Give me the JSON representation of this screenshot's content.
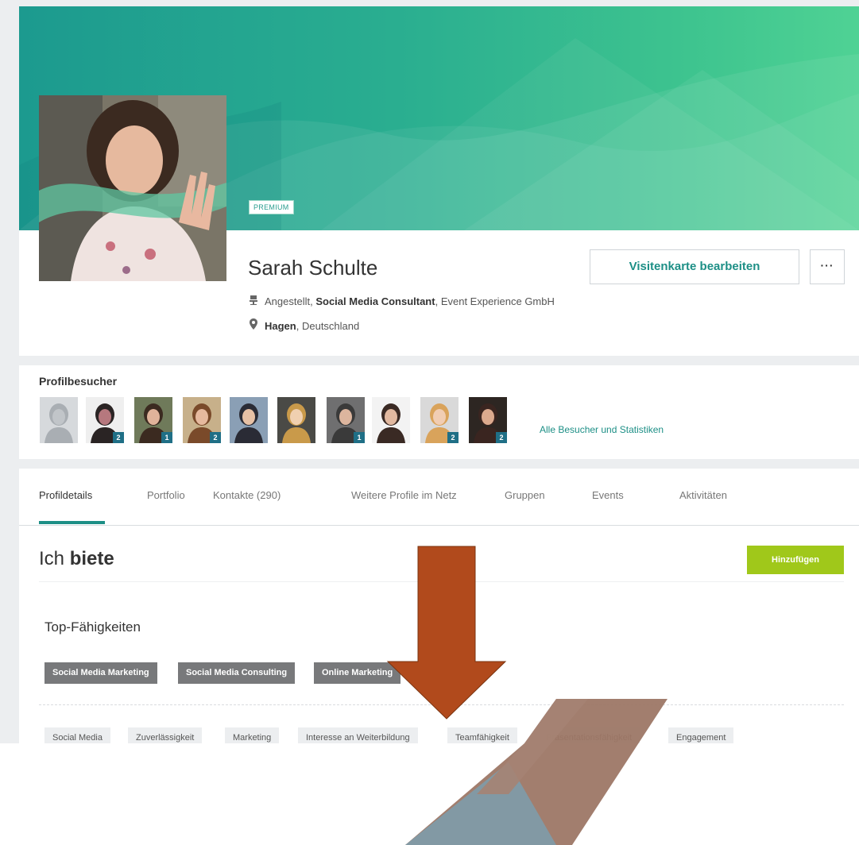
{
  "profile": {
    "badge": "PREMIUM",
    "name": "Sarah Schulte",
    "employment_prefix": "Angestellt, ",
    "position": "Social Media Consultant",
    "company_sep": ", ",
    "company": "Event Experience GmbH",
    "city": "Hagen",
    "country_sep": ", ",
    "country": "Deutschland",
    "edit_card_button": "Visitenkarte bearbeiten",
    "more_button": "···"
  },
  "visitors": {
    "title": "Profilbesucher",
    "items": [
      {
        "badge": ""
      },
      {
        "badge": "2"
      },
      {
        "badge": "1"
      },
      {
        "badge": "2"
      },
      {
        "badge": ""
      },
      {
        "badge": ""
      },
      {
        "badge": "1"
      },
      {
        "badge": ""
      },
      {
        "badge": "2"
      },
      {
        "badge": "2"
      }
    ],
    "link": "Alle Besucher und Statistiken"
  },
  "tabs": [
    {
      "label": "Profildetails",
      "active": true
    },
    {
      "label": "Portfolio"
    },
    {
      "label": "Kontakte (290)"
    },
    {
      "label": "Weitere Profile im Netz"
    },
    {
      "label": "Gruppen"
    },
    {
      "label": "Events"
    },
    {
      "label": "Aktivitäten"
    }
  ],
  "offer": {
    "title_part1": "Ich ",
    "title_part2": "biete",
    "add_button": "Hinzufügen",
    "top_skills_title": "Top-Fähigkeiten",
    "top_skills": [
      "Social Media Marketing",
      "Social Media Consulting",
      "Online Marketing"
    ],
    "skills": [
      "Social Media",
      "Zuverlässigkeit",
      "Marketing",
      "Interesse an Weiterbildung",
      "Teamfähigkeit",
      "Präsentationsfähigkeit",
      "Engagement"
    ]
  },
  "icons": {
    "employment": "office-chair-icon",
    "location": "map-pin-icon",
    "overlay": "down-arrow-icon"
  },
  "colors": {
    "brand": "#1d8f86",
    "add_button": "#a0c81a",
    "badge": "#1f6f86",
    "arrow": "#b14a1c"
  }
}
